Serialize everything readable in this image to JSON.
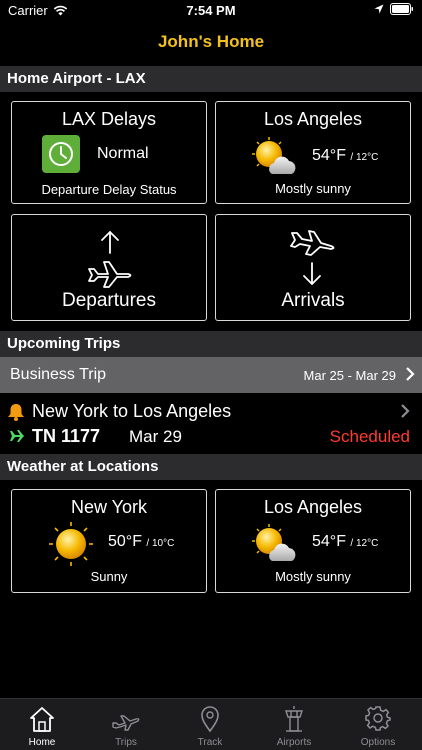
{
  "status_bar": {
    "carrier": "Carrier",
    "time": "7:54 PM"
  },
  "nav": {
    "title": "John's Home"
  },
  "home_airport": {
    "header": "Home Airport - LAX",
    "delays": {
      "title": "LAX Delays",
      "value": "Normal",
      "caption": "Departure Delay Status"
    },
    "weather": {
      "title": "Los Angeles",
      "temp_f": "54°F",
      "temp_c": "/ 12°C",
      "condition": "Mostly sunny"
    },
    "departures_label": "Departures",
    "arrivals_label": "Arrivals"
  },
  "upcoming": {
    "header": "Upcoming Trips",
    "group": {
      "name": "Business Trip",
      "dates": "Mar 25 - Mar 29"
    },
    "trip": {
      "route": "New York to Los Angeles",
      "flight": "TN 1177",
      "date": "Mar 29",
      "status": "Scheduled"
    }
  },
  "weather_locations": {
    "header": "Weather at Locations",
    "items": [
      {
        "city": "New York",
        "temp_f": "50°F",
        "temp_c": "/ 10°C",
        "condition": "Sunny"
      },
      {
        "city": "Los Angeles",
        "temp_f": "54°F",
        "temp_c": "/ 12°C",
        "condition": "Mostly sunny"
      }
    ]
  },
  "tabs": [
    {
      "label": "Home",
      "icon": "house-icon",
      "active": true
    },
    {
      "label": "Trips",
      "icon": "plane-icon",
      "active": false
    },
    {
      "label": "Track",
      "icon": "location-pin-icon",
      "active": false
    },
    {
      "label": "Airports",
      "icon": "control-tower-icon",
      "active": false
    },
    {
      "label": "Options",
      "icon": "gear-icon",
      "active": false
    }
  ],
  "colors": {
    "accent": "#f2c11d",
    "status_scheduled": "#ff3b30",
    "delay_normal": "#5fae3a"
  }
}
